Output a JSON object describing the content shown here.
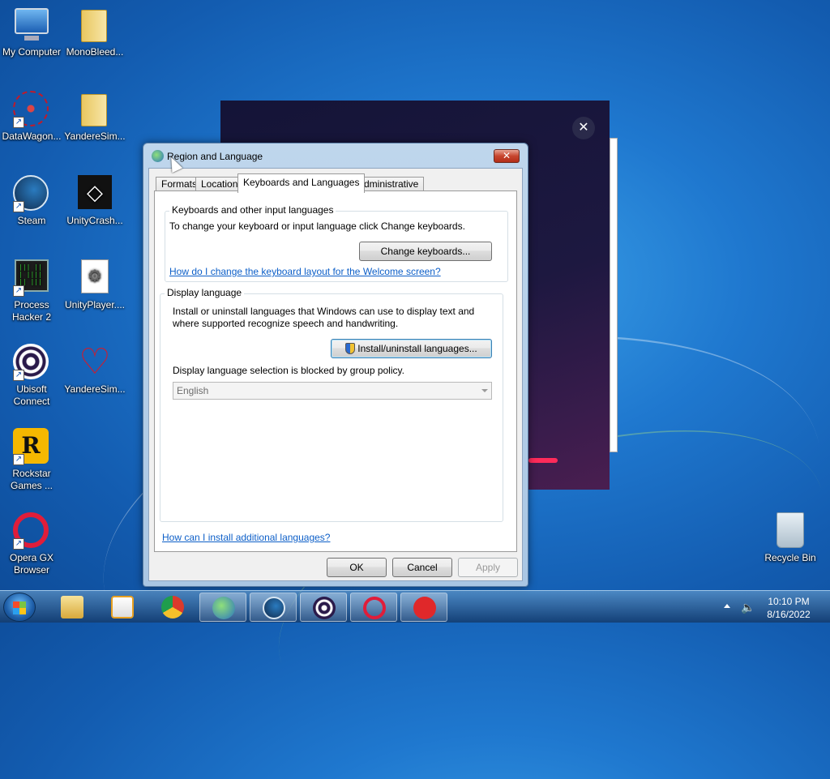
{
  "desktop": {
    "icons": [
      {
        "label": "My Computer"
      },
      {
        "label": "MonoBleed..."
      },
      {
        "label": "DataWagon..."
      },
      {
        "label": "YandereSim..."
      },
      {
        "label": "Steam"
      },
      {
        "label": "UnityCrash..."
      },
      {
        "label": "Process Hacker 2"
      },
      {
        "label": "UnityPlayer...."
      },
      {
        "label": "Ubisoft Connect"
      },
      {
        "label": "YandereSim..."
      },
      {
        "label": "Rockstar Games ..."
      },
      {
        "label": "Opera GX Browser"
      },
      {
        "label": "Recycle Bin"
      }
    ]
  },
  "background_window": {
    "close_glyph": "✕"
  },
  "dialog": {
    "title": "Region and Language",
    "close_glyph": "✕",
    "tabs": [
      {
        "label": "Formats"
      },
      {
        "label": "Location"
      },
      {
        "label": "Keyboards and Languages"
      },
      {
        "label": "Administrative"
      }
    ],
    "keyboards_group": {
      "label": "Keyboards and other input languages",
      "description": "To change your keyboard or input language click Change keyboards.",
      "button": "Change keyboards...",
      "link": "How do I change the keyboard layout for the Welcome screen?"
    },
    "display_group": {
      "label": "Display language",
      "description_line1": "Install or uninstall languages that Windows can use to display text and",
      "description_line2": "where supported recognize speech and handwriting.",
      "button": "Install/uninstall languages...",
      "blocked_text": "Display language selection is blocked by group policy.",
      "select_value": "English"
    },
    "bottom_link": "How can I install additional languages?",
    "buttons": {
      "ok": "OK",
      "cancel": "Cancel",
      "apply": "Apply"
    }
  },
  "taskbar": {
    "time": "10:10 PM",
    "date": "8/16/2022"
  }
}
